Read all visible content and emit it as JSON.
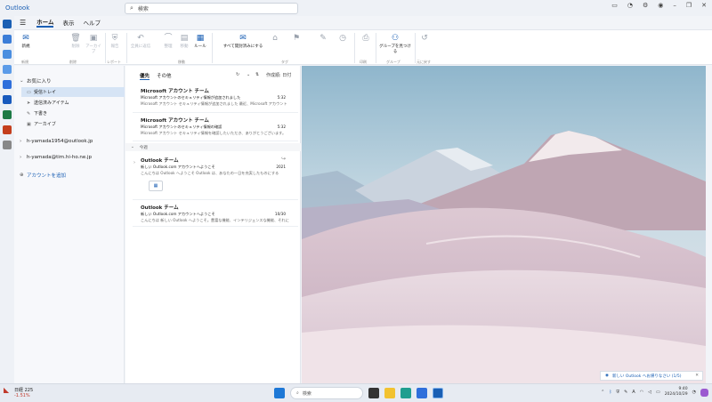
{
  "app": {
    "title": "Outlook"
  },
  "search": {
    "placeholder": "検索"
  },
  "ribbon": {
    "tabs": [
      "ホーム",
      "表示",
      "ヘルプ"
    ],
    "active_tab": "ホーム",
    "buttons": {
      "new": "新規",
      "delete": "削除",
      "archive": "アーカイブ",
      "report": "報告",
      "reply_all": "全員に返信",
      "sweep": "整理",
      "move": "移動",
      "rules": "ルール",
      "mark_all_read": "すべて開封済みにする",
      "find_groups": "グループを見つける"
    },
    "groups": {
      "new": "新規",
      "delete": "削除",
      "report": "レポート",
      "move": "移動",
      "tags": "タグ",
      "print": "印刷",
      "groups": "グループ",
      "undo": "元に戻す"
    }
  },
  "folders": {
    "favorites_header": "お気に入り",
    "favorites": [
      {
        "label": "受信トレイ",
        "icon": "inbox-icon",
        "selected": true
      },
      {
        "label": "送信済みアイテム",
        "icon": "send-icon",
        "selected": false
      },
      {
        "label": "下書き",
        "icon": "draft-icon",
        "selected": false
      },
      {
        "label": "アーカイブ",
        "icon": "archive-icon",
        "selected": false
      }
    ],
    "accounts": [
      "h-yamada1954@outlook.jp",
      "h-yamada@tim.hi-ho.ne.jp"
    ],
    "add_account": "アカウントを追加"
  },
  "message_list": {
    "tabs": [
      "優先",
      "その他"
    ],
    "active_tab": "優先",
    "sort_label": "作成順: 日付",
    "group_label": "今週",
    "messages": [
      {
        "from": "Microsoft アカウント チーム",
        "subject": "Microsoft アカウントのセキュリティ情報が追加されました",
        "time": "5:32",
        "preview": "Microsoft アカウント セキュリティ情報が追加されました 最近、Microsoft アカウント"
      },
      {
        "from": "Microsoft アカウント チーム",
        "subject": "Microsoft アカウントのセキュリティ情報の確認",
        "time": "5:32",
        "preview": "Microsoft アカウント セキュリティ情報を確認したいただき、ありがとうございます。"
      },
      {
        "from": "Outlook チーム",
        "subject": "新しい Outlook.com アカウントへようこそ",
        "time": "2021",
        "preview": "こんにちは Outlook へようこそ Outlook は、あなたの一日を充実したものにする"
      },
      {
        "from": "Outlook チーム",
        "subject": "新しい Outlook.com アカウントへようこそ",
        "time": "10/30",
        "preview": "こんにちは 新しい Outlook へようこそ。豊富な機能、インテリジェンスな機能、それに"
      }
    ]
  },
  "reading_pane": {
    "toast": "新しい Outlook へお帰りなさい (1/5)"
  },
  "taskbar": {
    "weather_temp": "日経 225",
    "weather_change": "-1.51%",
    "search_placeholder": "検索",
    "tray_lang": "A",
    "clock_time": "9:40",
    "clock_date": "2024/10/29"
  },
  "colors": {
    "accent": "#1a5fb4",
    "selected_folder": "#d6e4f5"
  }
}
